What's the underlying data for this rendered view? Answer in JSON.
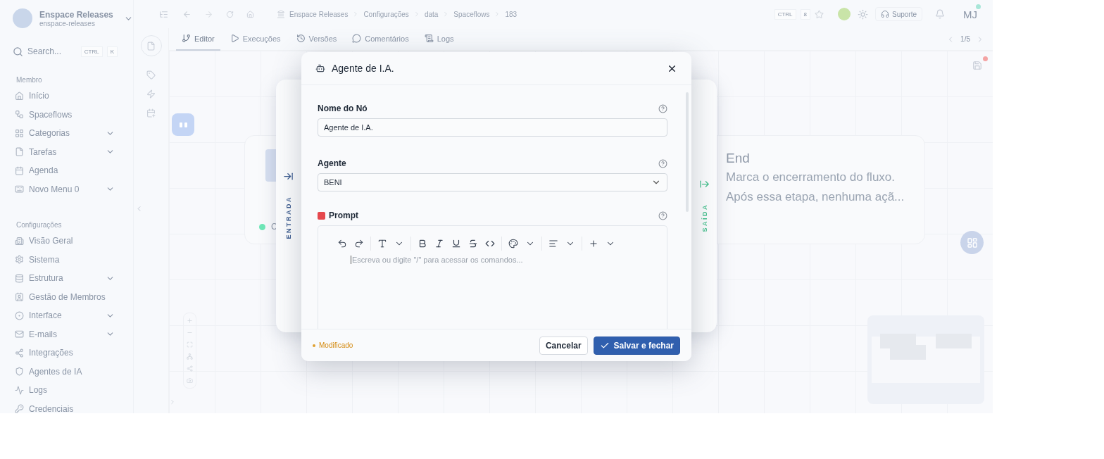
{
  "workspace": {
    "name": "Enspace Releases",
    "slug": "enspace-releases"
  },
  "search": {
    "placeholder": "Search...",
    "keys": [
      "CTRL",
      "K"
    ]
  },
  "sidebar": {
    "sections": [
      {
        "title": "Membro",
        "items": [
          {
            "label": "Início",
            "expandable": false
          },
          {
            "label": "Spaceflows",
            "expandable": false
          },
          {
            "label": "Categorias",
            "expandable": true
          },
          {
            "label": "Tarefas",
            "expandable": true
          },
          {
            "label": "Agenda",
            "expandable": false
          },
          {
            "label": "Novo Menu 0",
            "expandable": true
          }
        ]
      },
      {
        "title": "Configurações",
        "items": [
          {
            "label": "Visão Geral",
            "expandable": false
          },
          {
            "label": "Sistema",
            "expandable": false
          },
          {
            "label": "Estrutura",
            "expandable": true
          },
          {
            "label": "Gestão de Membros",
            "expandable": false
          },
          {
            "label": "Interface",
            "expandable": true
          },
          {
            "label": "E-mails",
            "expandable": true
          },
          {
            "label": "Integrações",
            "expandable": false
          },
          {
            "label": "Agentes de IA",
            "expandable": false
          },
          {
            "label": "Logs",
            "expandable": false
          },
          {
            "label": "Credenciais",
            "expandable": false
          }
        ]
      }
    ]
  },
  "breadcrumb": [
    "Enspace Releases",
    "Configurações",
    "data",
    "Spaceflows",
    "183"
  ],
  "shortcut": [
    "CTRL",
    "8"
  ],
  "support": "Suporte",
  "avatar": "MJ",
  "tabs": [
    {
      "label": "Editor",
      "selected": true
    },
    {
      "label": "Execuções",
      "selected": false
    },
    {
      "label": "Versões",
      "selected": false
    },
    {
      "label": "Comentários",
      "selected": false
    },
    {
      "label": "Logs",
      "selected": false
    }
  ],
  "pager": "1/5",
  "canvas": {
    "start_node": {
      "label": "C",
      "color": "#6ee7b7"
    },
    "end_node": {
      "title": "End",
      "lines": [
        "Marca o encerramento do fluxo.",
        "Após essa etapa, nenhuma açã..."
      ]
    },
    "unsaved": true
  },
  "panel": {
    "input_label": "ENTRADA",
    "output_label": "SAÍDA"
  },
  "modal": {
    "title": "Agente de I.A.",
    "fields": [
      {
        "kind": "text",
        "label": "Nome do Nó",
        "value": "Agente de I.A.",
        "required": false
      },
      {
        "kind": "select",
        "label": "Agente",
        "value": "BENI",
        "required": false
      },
      {
        "kind": "editor",
        "label": "Prompt",
        "placeholder": "Escreva ou digite \"/\" para acessar os comandos...",
        "required": true
      }
    ],
    "status": "Modificado",
    "buttons": [
      {
        "label": "Cancelar",
        "kind": "secondary"
      },
      {
        "label": "Salvar e fechar",
        "kind": "primary"
      }
    ]
  }
}
